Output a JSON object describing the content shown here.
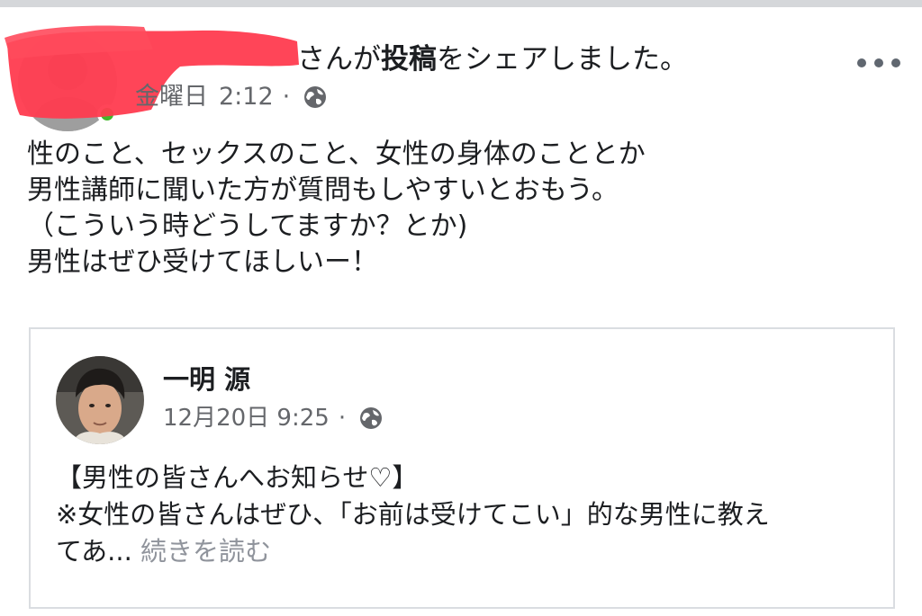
{
  "post": {
    "author_suffix": "さんが",
    "action_bold": "投稿",
    "action_rest": "をシェアしました。",
    "day": "金曜日",
    "time": "2:12",
    "separator": "·",
    "privacy_icon": "globe-icon",
    "more_icon": "more-options-icon",
    "body_lines": [
      "性のこと、セックスのこと、女性の身体のこととか",
      "男性講師に聞いた方が質問もしやすいとおもう。",
      "（こういう時どうしてますか？とか)",
      "男性はぜひ受けてほしいー！"
    ]
  },
  "shared": {
    "author_name": "一明 源",
    "date": "12月20日 9:25",
    "separator": "·",
    "privacy_icon": "globe-icon",
    "text_lines": [
      "【男性の皆さんへお知らせ♡】",
      "※女性の皆さんはぜひ、「お前は受けてこい」的な男性に教え"
    ],
    "last_line_prefix": "てあ...",
    "see_more": "続きを読む"
  },
  "colors": {
    "redaction": "#ff3b4f",
    "meta_gray": "#65676b",
    "see_more_gray": "#90949c",
    "card_border": "#dadde1",
    "online_green": "#42b72a"
  }
}
